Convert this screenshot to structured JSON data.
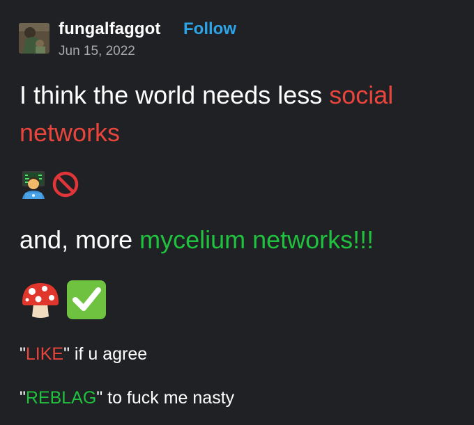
{
  "post": {
    "author": "fungalfaggot",
    "follow_label": "Follow",
    "date": "Jun 15, 2022",
    "line1_pre": "I think the world needs less ",
    "line1_red": "social",
    "line2_red": "networks",
    "line3_pre": "and, more ",
    "line3_green": "mycelium networks!!!",
    "like_open": "\"",
    "like_word": "LIKE",
    "like_rest": "\" if u agree",
    "reblag_open": "\"",
    "reblag_word": "REBLAG",
    "reblag_rest": "\" to fuck me nasty"
  },
  "icons": {
    "row1": [
      "technologist-emoji",
      "prohibited-emoji"
    ],
    "row2": [
      "mushroom-emoji",
      "check-mark-button-emoji"
    ]
  },
  "colors": {
    "background": "#202124",
    "follow": "#2ea4e8",
    "red_text": "#e8453c",
    "green_text": "#20c13f",
    "date": "#a7a9ac"
  }
}
